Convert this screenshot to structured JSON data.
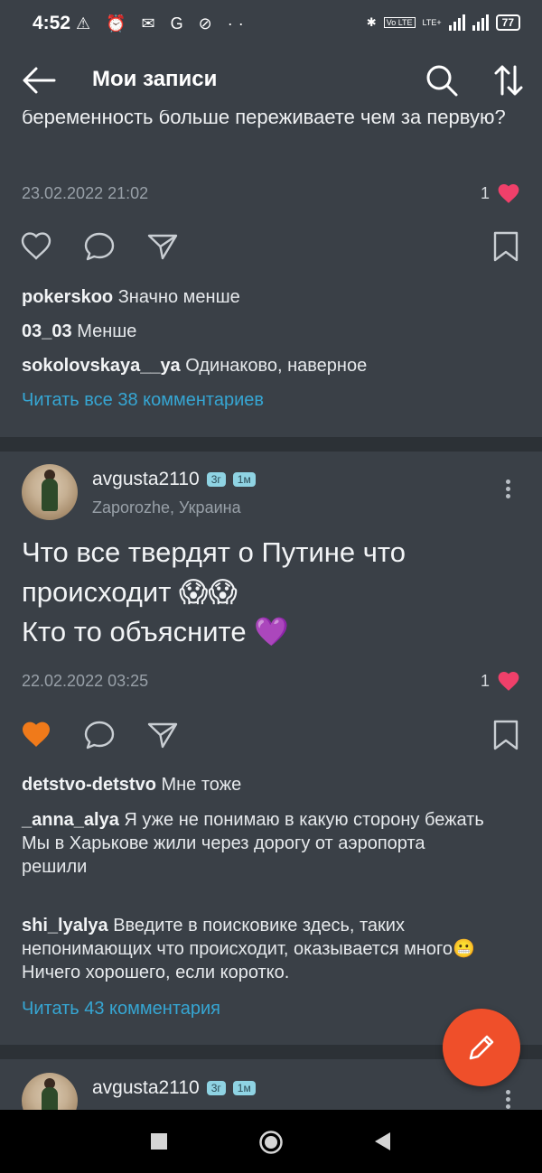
{
  "status_bar": {
    "time": "4:52",
    "icons_left": "⚠ ⏰ ✉ G ⊘ ··",
    "volte": "Vo LTE",
    "lte": "LTE+",
    "battery": "77"
  },
  "header": {
    "title": "Мои записи"
  },
  "post1": {
    "text_tail": "беременность больше переживаете чем за первую?",
    "date": "23.02.2022 21:02",
    "likes": "1",
    "liked": false,
    "comments": [
      {
        "user": "pokerskoo",
        "text": "Значно менше"
      },
      {
        "user": "03_03",
        "text": "Менше"
      },
      {
        "user": "sokolovskaya__ya",
        "text": "Одинаково, наверное"
      }
    ],
    "read_all": "Читать все 38 комментариев"
  },
  "post2": {
    "author": "avgusta2110",
    "badge_age": "3г",
    "badge_time": "1м",
    "location": "Zaporozhe, Украина",
    "text_line1": "Что все твердят о Путине что",
    "text_line2": "происходит 😱😱",
    "text_line3": "Кто то объясните 💜",
    "date": "22.02.2022 03:25",
    "likes": "1",
    "liked": true,
    "comments": [
      {
        "user": "detstvo-detstvo",
        "text": "Мне тоже"
      },
      {
        "user": "_anna_alya",
        "text": "Я уже не понимаю в какую сторону бежать",
        "text2": "Мы в Харькове жили через дорогу от аэропорта решили"
      },
      {
        "user": "shi_lyalya",
        "text": "Введите в поисковике здесь, таких непонимающих что происходит, оказывается много😬 Ничего хорошего, если коротко."
      }
    ],
    "read_all": "Читать 43 комментария"
  },
  "post3": {
    "author": "avgusta2110",
    "badge_age": "3г",
    "badge_time": "1м"
  },
  "colors": {
    "background": "#3a4047",
    "divider": "#2c3136",
    "link": "#36a6d3",
    "like_heart": "#f0406a",
    "liked_orange": "#f07a1a",
    "fab": "#ef4f2a"
  }
}
